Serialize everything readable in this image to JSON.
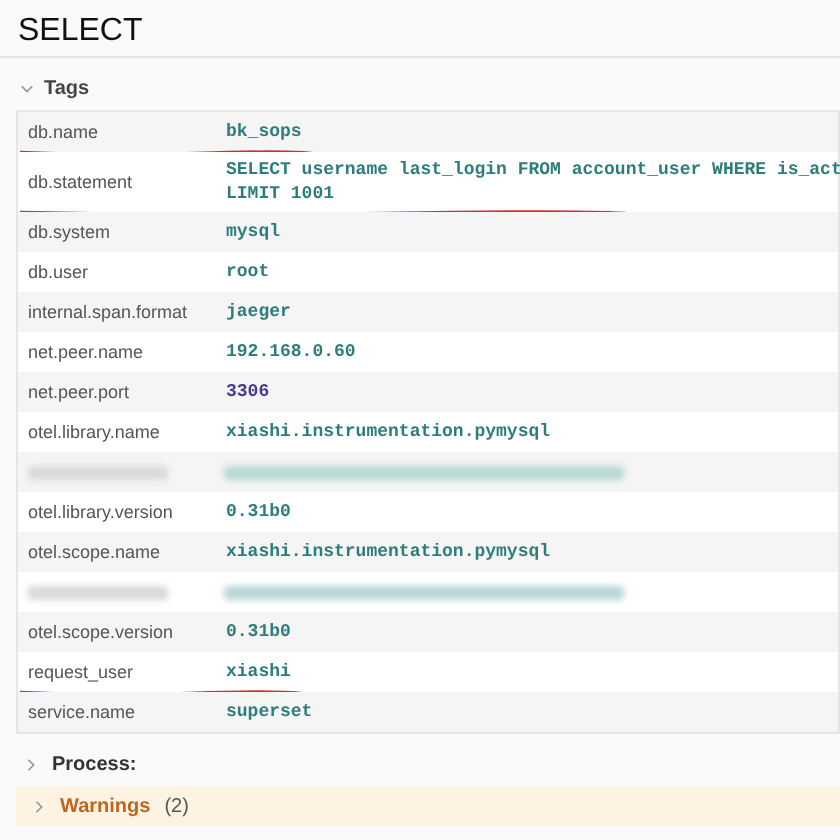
{
  "title": "SELECT",
  "tags": {
    "label": "Tags",
    "expanded": true,
    "rows": [
      {
        "kind": "string",
        "key": "db.name",
        "value": [
          "bk_sops"
        ],
        "underlined": true
      },
      {
        "kind": "string",
        "key": "db.statement",
        "value": [
          "SELECT username last_login FROM account_user WHERE is_act",
          "LIMIT 1001"
        ],
        "underlined": true
      },
      {
        "kind": "string",
        "key": "db.system",
        "value": [
          "mysql"
        ],
        "underlined": false
      },
      {
        "kind": "string",
        "key": "db.user",
        "value": [
          "root"
        ],
        "underlined": false
      },
      {
        "kind": "string",
        "key": "internal.span.format",
        "value": [
          "jaeger"
        ],
        "underlined": false
      },
      {
        "kind": "string",
        "key": "net.peer.name",
        "value": [
          "192.168.0.60"
        ],
        "underlined": false
      },
      {
        "kind": "number",
        "key": "net.peer.port",
        "value": [
          "3306"
        ],
        "underlined": false
      },
      {
        "kind": "string",
        "key": "otel.library.name",
        "value": [
          "xiashi.instrumentation.pymysql"
        ],
        "underlined": false
      },
      {
        "kind": "redacted"
      },
      {
        "kind": "string",
        "key": "otel.library.version",
        "value": [
          "0.31b0"
        ],
        "underlined": false
      },
      {
        "kind": "string",
        "key": "otel.scope.name",
        "value": [
          "xiashi.instrumentation.pymysql"
        ],
        "underlined": false
      },
      {
        "kind": "redacted"
      },
      {
        "kind": "string",
        "key": "otel.scope.version",
        "value": [
          "0.31b0"
        ],
        "underlined": false
      },
      {
        "kind": "string",
        "key": "request_user",
        "value": [
          "xiashi"
        ],
        "underlined": true
      },
      {
        "kind": "string",
        "key": "service.name",
        "value": [
          "superset"
        ],
        "underlined": false
      }
    ]
  },
  "process": {
    "label": "Process:",
    "expanded": false
  },
  "warnings": {
    "label": "Warnings",
    "count": "(2)",
    "expanded": false
  }
}
